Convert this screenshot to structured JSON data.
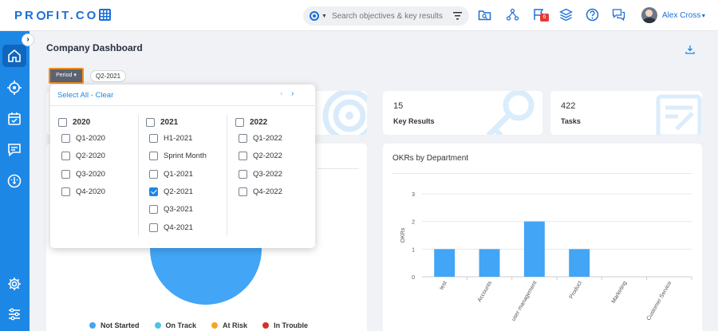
{
  "app": {
    "logo": "PR",
    "logo_tail": "FIT.CO"
  },
  "search": {
    "placeholder": "Search objectives & key results"
  },
  "notifications": {
    "count": "6"
  },
  "user": {
    "name": "Alex Cross"
  },
  "page": {
    "title": "Company Dashboard"
  },
  "period": {
    "button_label": "Period",
    "selected": "Q2-2021"
  },
  "dropdown": {
    "select_all": "Select All",
    "separator": " - ",
    "clear": "Clear",
    "columns": [
      {
        "year": "2020",
        "items": [
          {
            "label": "Q1-2020",
            "checked": false
          },
          {
            "label": "Q2-2020",
            "checked": false
          },
          {
            "label": "Q3-2020",
            "checked": false
          },
          {
            "label": "Q4-2020",
            "checked": false
          }
        ]
      },
      {
        "year": "2021",
        "items": [
          {
            "label": "H1-2021",
            "checked": false
          },
          {
            "label": "Sprint Month",
            "checked": false
          },
          {
            "label": "Q1-2021",
            "checked": false
          },
          {
            "label": "Q2-2021",
            "checked": true
          },
          {
            "label": "Q3-2021",
            "checked": false
          },
          {
            "label": "Q4-2021",
            "checked": false
          }
        ]
      },
      {
        "year": "2022",
        "items": [
          {
            "label": "Q1-2022",
            "checked": false
          },
          {
            "label": "Q2-2022",
            "checked": false
          },
          {
            "label": "Q3-2022",
            "checked": false
          },
          {
            "label": "Q4-2022",
            "checked": false
          }
        ]
      }
    ]
  },
  "stats": {
    "key_results": {
      "value": "15",
      "label": "Key Results"
    },
    "tasks": {
      "value": "422",
      "label": "Tasks"
    }
  },
  "okr_chart_title": "OKRs by Department",
  "legend": [
    {
      "label": "Not Started",
      "color": "#42a5f5"
    },
    {
      "label": "On Track",
      "color": "#4fc3e0"
    },
    {
      "label": "At Risk",
      "color": "#f5a623"
    },
    {
      "label": "In Trouble",
      "color": "#d0342c"
    }
  ],
  "chart_data": {
    "type": "bar",
    "title": "OKRs by Department",
    "xlabel": "",
    "ylabel": "OKRs",
    "categories": [
      "test",
      "Accounts",
      "user management",
      "Product",
      "Marketing",
      "Customer Service"
    ],
    "values": [
      1,
      1,
      2,
      1,
      0,
      0
    ],
    "ylim": [
      0,
      3
    ],
    "yticks": [
      0,
      1,
      2,
      3
    ],
    "grid": true,
    "color": "#42a5f5"
  }
}
